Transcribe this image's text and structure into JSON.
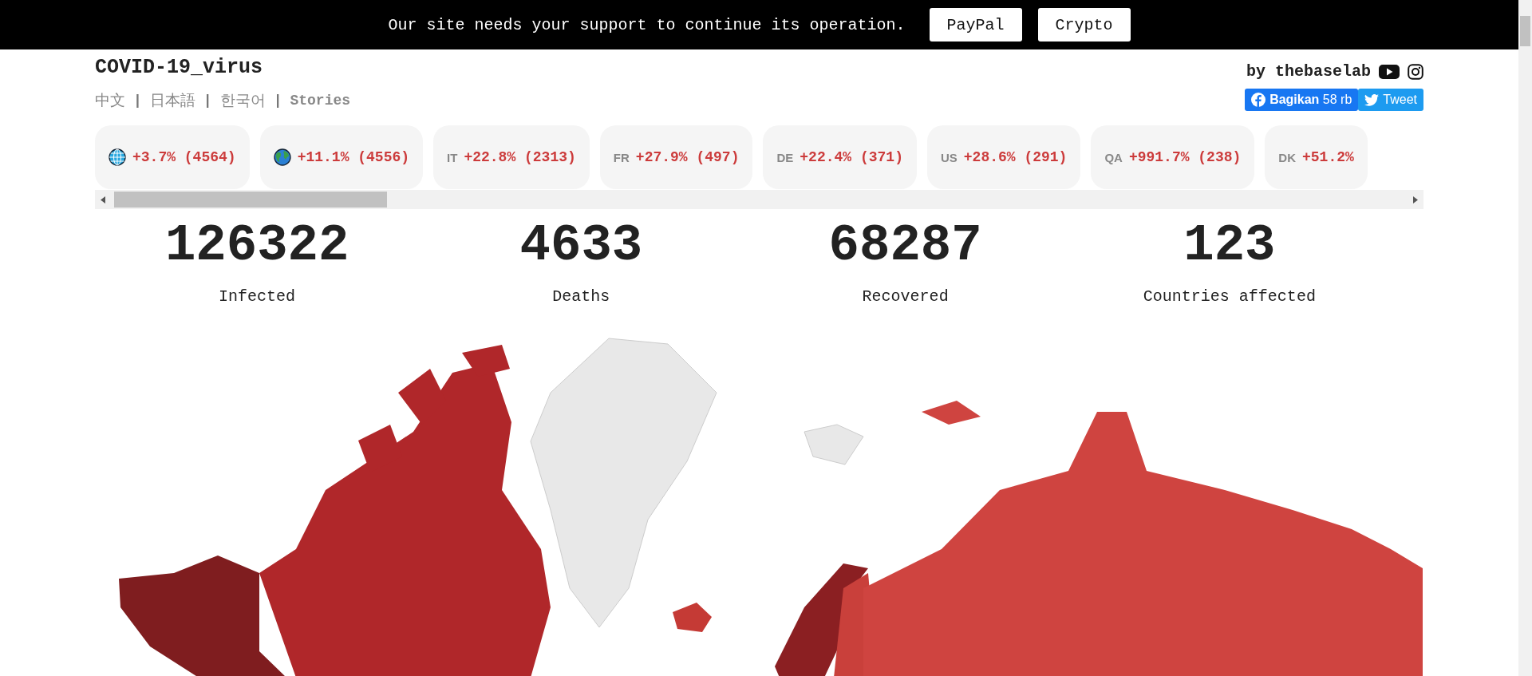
{
  "banner": {
    "message": "Our site needs your support to continue its operation.",
    "buttons": [
      "PayPal",
      "Crypto"
    ]
  },
  "header": {
    "title": "COVID-19_virus",
    "nav": [
      {
        "kind": "language",
        "label": "中文"
      },
      {
        "kind": "separator",
        "label": "|"
      },
      {
        "kind": "language",
        "label": "日本語"
      },
      {
        "kind": "separator",
        "label": "|"
      },
      {
        "kind": "language",
        "label": "한국어"
      },
      {
        "kind": "separator",
        "label": "|"
      },
      {
        "kind": "stories",
        "label": "Stories"
      }
    ],
    "byline": "by thebaselab",
    "share": {
      "facebook": "**Bagikan** 58 rb",
      "tweet": "Tweet"
    }
  },
  "ticker": [
    {
      "kind": "world",
      "change": "+3.7% (4564)"
    },
    {
      "kind": "earth",
      "change": "+11.1% (4556)"
    },
    {
      "kind": "country",
      "code": "IT",
      "change": "+22.8% (2313)"
    },
    {
      "kind": "country",
      "code": "FR",
      "change": "+27.9% (497)"
    },
    {
      "kind": "country",
      "code": "DE",
      "change": "+22.4% (371)"
    },
    {
      "kind": "country",
      "code": "US",
      "change": "+28.6% (291)"
    },
    {
      "kind": "country",
      "code": "QA",
      "change": "+991.7% (238)"
    },
    {
      "kind": "country",
      "code": "DK",
      "change": "+51.2%"
    }
  ],
  "stats": [
    {
      "value": "126322",
      "label": "Infected"
    },
    {
      "value": "4633",
      "label": "Deaths"
    },
    {
      "value": "68287",
      "label": "Recovered"
    },
    {
      "value": "123",
      "label": "Countries affected"
    }
  ]
}
